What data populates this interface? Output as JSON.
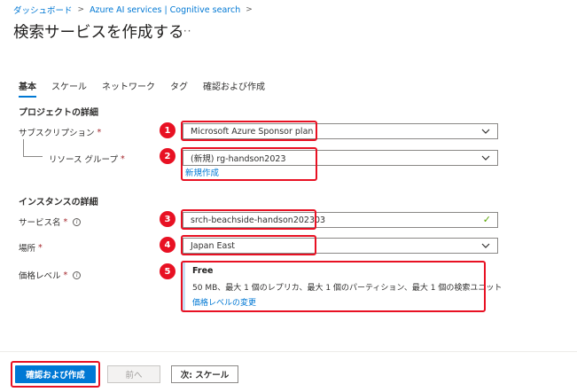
{
  "breadcrumb": {
    "items": [
      "ダッシュボード",
      "Azure AI services | Cognitive search"
    ],
    "separator": ">"
  },
  "page": {
    "title": "検索サービスを作成する",
    "more_label": "···"
  },
  "tabs": [
    {
      "label": "基本",
      "active": true
    },
    {
      "label": "スケール",
      "active": false
    },
    {
      "label": "ネットワーク",
      "active": false
    },
    {
      "label": "タグ",
      "active": false
    },
    {
      "label": "確認および作成",
      "active": false
    }
  ],
  "project_details": {
    "heading": "プロジェクトの詳細",
    "subscription": {
      "label": "サブスクリプション",
      "required": "*",
      "value": "Microsoft Azure Sponsor plan"
    },
    "resource_group": {
      "label": "リソース グループ",
      "required": "*",
      "value": "(新規) rg-handson2023",
      "create_new_link": "新規作成"
    }
  },
  "instance_details": {
    "heading": "インスタンスの詳細",
    "service_name": {
      "label": "サービス名",
      "required": "*",
      "value": "srch-beachside-handson202303"
    },
    "location": {
      "label": "場所",
      "required": "*",
      "value": "Japan East"
    },
    "pricing_tier": {
      "label": "価格レベル",
      "required": "*",
      "tier": "Free",
      "description": "50 MB、最大 1 個のレプリカ、最大 1 個のパーティション、最大 1 個の検索ユニット",
      "change_link": "価格レベルの変更"
    }
  },
  "annotations": [
    "1",
    "2",
    "3",
    "4",
    "5"
  ],
  "footer": {
    "review_create": "確認および作成",
    "previous": "前へ",
    "next": "次: スケール"
  },
  "colors": {
    "accent": "#0078d4",
    "highlight": "#e81123",
    "required": "#a4262c",
    "valid": "#57a300"
  },
  "icons": {
    "dropdown": "chevron-down-icon",
    "valid": "check-icon",
    "info": "info-icon"
  }
}
